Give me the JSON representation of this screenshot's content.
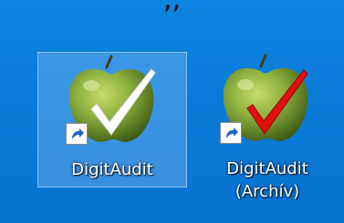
{
  "window_title_fragment": ",,",
  "desktop_icons": [
    {
      "label": "DigitAudit",
      "icon": "green-apple-white-check-icon",
      "selected": true
    },
    {
      "label_line1": "DigitAudit",
      "label_line2": "(Archív)",
      "icon": "green-apple-red-check-icon",
      "selected": false
    }
  ],
  "colors": {
    "desktop_background": "#0a7bd9",
    "apple_green": "#7fa33b",
    "check_white": "#ffffff",
    "check_red": "#e01010",
    "label_text": "#ffffff"
  }
}
